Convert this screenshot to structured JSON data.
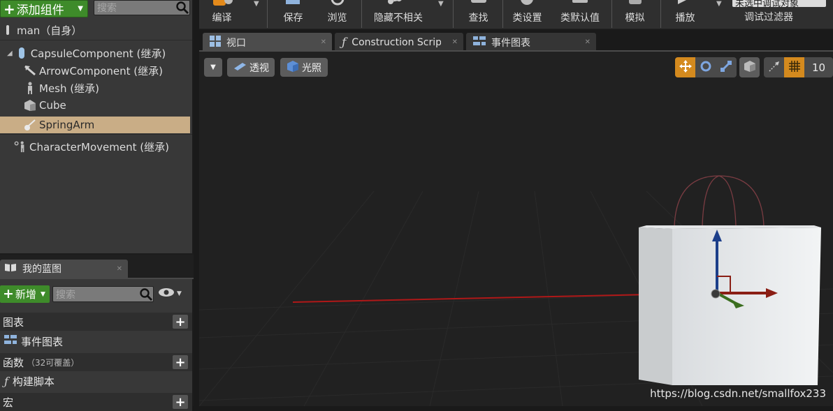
{
  "components": {
    "add_label": "添加组件",
    "search_placeholder": "搜索",
    "root": "man（自身）",
    "items": [
      {
        "label": "CapsuleComponent (继承)"
      },
      {
        "label": "ArrowComponent (继承)"
      },
      {
        "label": "Mesh (继承)"
      },
      {
        "label": "Cube"
      },
      {
        "label": "SpringArm"
      },
      {
        "label": "CharacterMovement (继承)"
      }
    ]
  },
  "my_blueprint": {
    "tab_label": "我的蓝图",
    "new_label": "新增",
    "search_placeholder": "搜索",
    "sections": [
      {
        "label": "图表",
        "items": [
          "事件图表"
        ]
      },
      {
        "label": "函数",
        "note": "（32可覆盖）",
        "items": [
          "构建脚本"
        ]
      },
      {
        "label": "宏",
        "items": []
      }
    ]
  },
  "toolbar": {
    "buttons": [
      "编译",
      "保存",
      "浏览",
      "隐藏不相关",
      "查找",
      "类设置",
      "类默认值",
      "模拟",
      "播放"
    ],
    "debug_object": "未选中调试对象",
    "debug_filter_label": "调试过滤器"
  },
  "tabs": [
    {
      "label": "视口",
      "active": true
    },
    {
      "label": "Construction Scrip",
      "active": false
    },
    {
      "label": "事件图表",
      "active": false
    }
  ],
  "viewport": {
    "perspective_label": "透视",
    "lighting_label": "光照",
    "grid_snap_value": "10",
    "watermark": "https://blog.csdn.net/smallfox233"
  },
  "colors": {
    "accent_green": "#3e8b2a",
    "selection": "#c9ad86",
    "snap_orange": "#d48a1e"
  }
}
